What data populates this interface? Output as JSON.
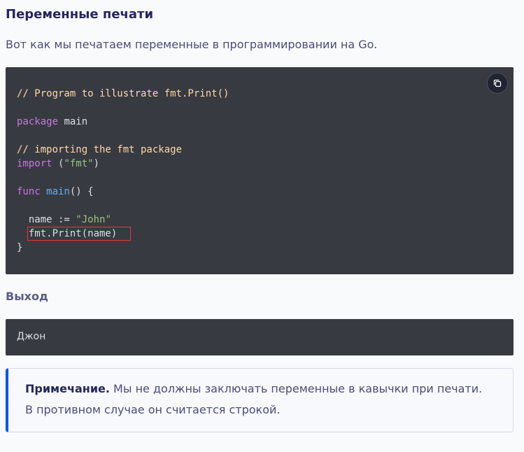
{
  "section": {
    "title": "Переменные печати",
    "intro": "Вот как мы печатаем переменные в программировании на Go."
  },
  "code": {
    "comment1": "// Program to illustrate fmt.Print()",
    "kw_package": "package",
    "pkg_name": " main",
    "comment2": "// importing the fmt package",
    "kw_import": "import",
    "import_open": " (",
    "import_str": "\"fmt\"",
    "import_close": ")",
    "kw_func": "func",
    "fn_space": " ",
    "fn_name": "main",
    "fn_sig": "() {",
    "assign_left": "  name := ",
    "assign_str": "\"John\"",
    "print_indent": "  ",
    "print_stmt": "fmt.Print(name)",
    "close_brace": "}",
    "copy_icon": "copy-icon"
  },
  "output": {
    "title": "Выход",
    "text": "Джон"
  },
  "note": {
    "label": "Примечание.",
    "line1": " Мы не должны заключать переменные в кавычки при печати.",
    "line2": "В противном случае он считается строкой."
  },
  "colors": {
    "accent": "#0556f3",
    "code_bg": "#383a42",
    "highlight": "#e53935"
  }
}
